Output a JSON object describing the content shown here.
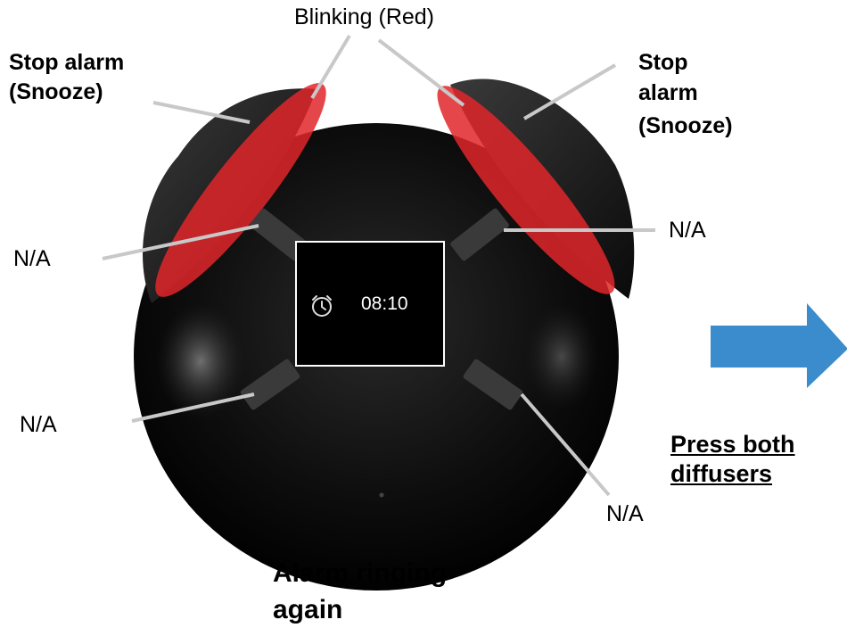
{
  "labels": {
    "top_center": "Blinking (Red)",
    "top_left_line1": "Stop alarm",
    "top_left_line2": "(Snooze)",
    "top_right_line1": "Stop",
    "top_right_line2": "alarm",
    "top_right_line3": "(Snooze)",
    "mid_left": "N/A",
    "mid_right": "N/A",
    "low_left": "N/A",
    "low_right": "N/A",
    "bottom_line1": "Alarm ringing",
    "bottom_line2": "again",
    "action_line1": "Press both",
    "action_line2": "diffusers"
  },
  "display": {
    "time": "08:10",
    "icon": "alarm-clock-icon"
  },
  "colors": {
    "device": "#111111",
    "highlight": "#e0262a",
    "arrow": "#3a8ccc",
    "leader": "#c8c8c8"
  }
}
